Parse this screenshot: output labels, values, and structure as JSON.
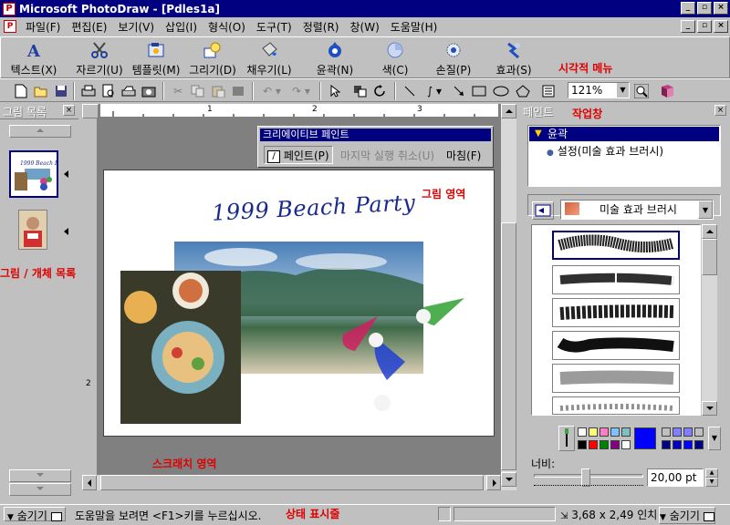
{
  "window": {
    "title": "Microsoft PhotoDraw - [Pdles1a]",
    "app_icon": "photodraw-icon"
  },
  "menubar": {
    "items": [
      "파일(F)",
      "편집(E)",
      "보기(V)",
      "삽입(I)",
      "형식(O)",
      "도구(T)",
      "정렬(R)",
      "창(W)",
      "도움말(H)"
    ]
  },
  "visual_menu": {
    "items": [
      "텍스트(X)",
      "자르기(U)",
      "템플릿(M)",
      "그리기(D)",
      "채우기(L)",
      "윤곽(N)",
      "색(C)",
      "손질(P)",
      "효과(S)"
    ],
    "caption": "시각적 메뉴"
  },
  "toolbar": {
    "zoom": "121%"
  },
  "left_panel": {
    "title": "그림 목록",
    "caption": "그림 / 개체 목록"
  },
  "canvas": {
    "picture_title": "1999 Beach Party",
    "canvas_caption": "그림 영역",
    "scratch_caption": "스크래치 영역",
    "ruler_numbers": [
      "1",
      "2",
      "3"
    ],
    "ruler_v_number": "2"
  },
  "creative_paint": {
    "title": "크리에이티브 페인트",
    "paint_button": "페인트(P)",
    "undo_button": "마지막 실행 취소(U)",
    "done_button": "마침(F)"
  },
  "task_pane": {
    "title": "페인트",
    "caption": "작업창",
    "tree_selected": "윤곽",
    "tree_child": "설정(미술 효과 브러시)",
    "brush_type": "미술 효과 브러시",
    "width_label": "너비:",
    "width_value": "20,00 pt"
  },
  "colors": {
    "palette_row1": [
      "#ffffff",
      "#ffff80",
      "#ff80c0",
      "#80c0ff",
      "#80c0c0"
    ],
    "palette_row2": [
      "#000000",
      "#ff0000",
      "#008000",
      "#800080",
      "#ffffff"
    ],
    "palette_row3": [
      "#c0c0c0",
      "#8080ff",
      "#8080ff",
      "#c0c0c0"
    ],
    "palette_row4": [
      "#000080",
      "#0000c0",
      "#0000ff",
      "#000080"
    ],
    "current": "#0000ff"
  },
  "statusbar": {
    "hide_left": "숨기기",
    "help_text": "도움말을 보려면 <F1>키를 누르십시오.",
    "caption": "상태 표시줄",
    "size": "3,68 x 2,49 인치",
    "hide_right": "숨기기"
  }
}
